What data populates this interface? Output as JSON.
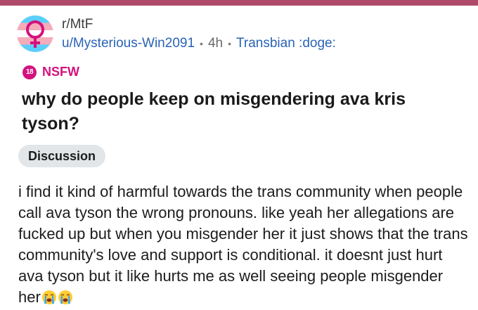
{
  "post": {
    "subreddit": "r/MtF",
    "username": "u/Mysterious-Win2091",
    "time": "4h",
    "user_flair": "Transbian :doge:",
    "nsfw_badge_number": "18",
    "nsfw_label": "NSFW",
    "title": "why do people keep on misgendering ava kris tyson?",
    "post_flair": "Discussion",
    "body": "i find it kind of harmful towards the trans community when people call ava tyson the wrong pronouns. like yeah her allegations are fucked up but when you misgender her it just shows that the trans community's love and support is conditional. it doesnt just hurt ava tyson but it like hurts me as well seeing people misgender her",
    "emojis": [
      "loudly-crying-face-icon",
      "loudly-crying-face-icon"
    ]
  },
  "colors": {
    "top_strip": "#b04a6b",
    "link_blue": "#2a63b5",
    "nsfw_pink": "#d4127e",
    "chip_bg": "#e2e6e9"
  }
}
